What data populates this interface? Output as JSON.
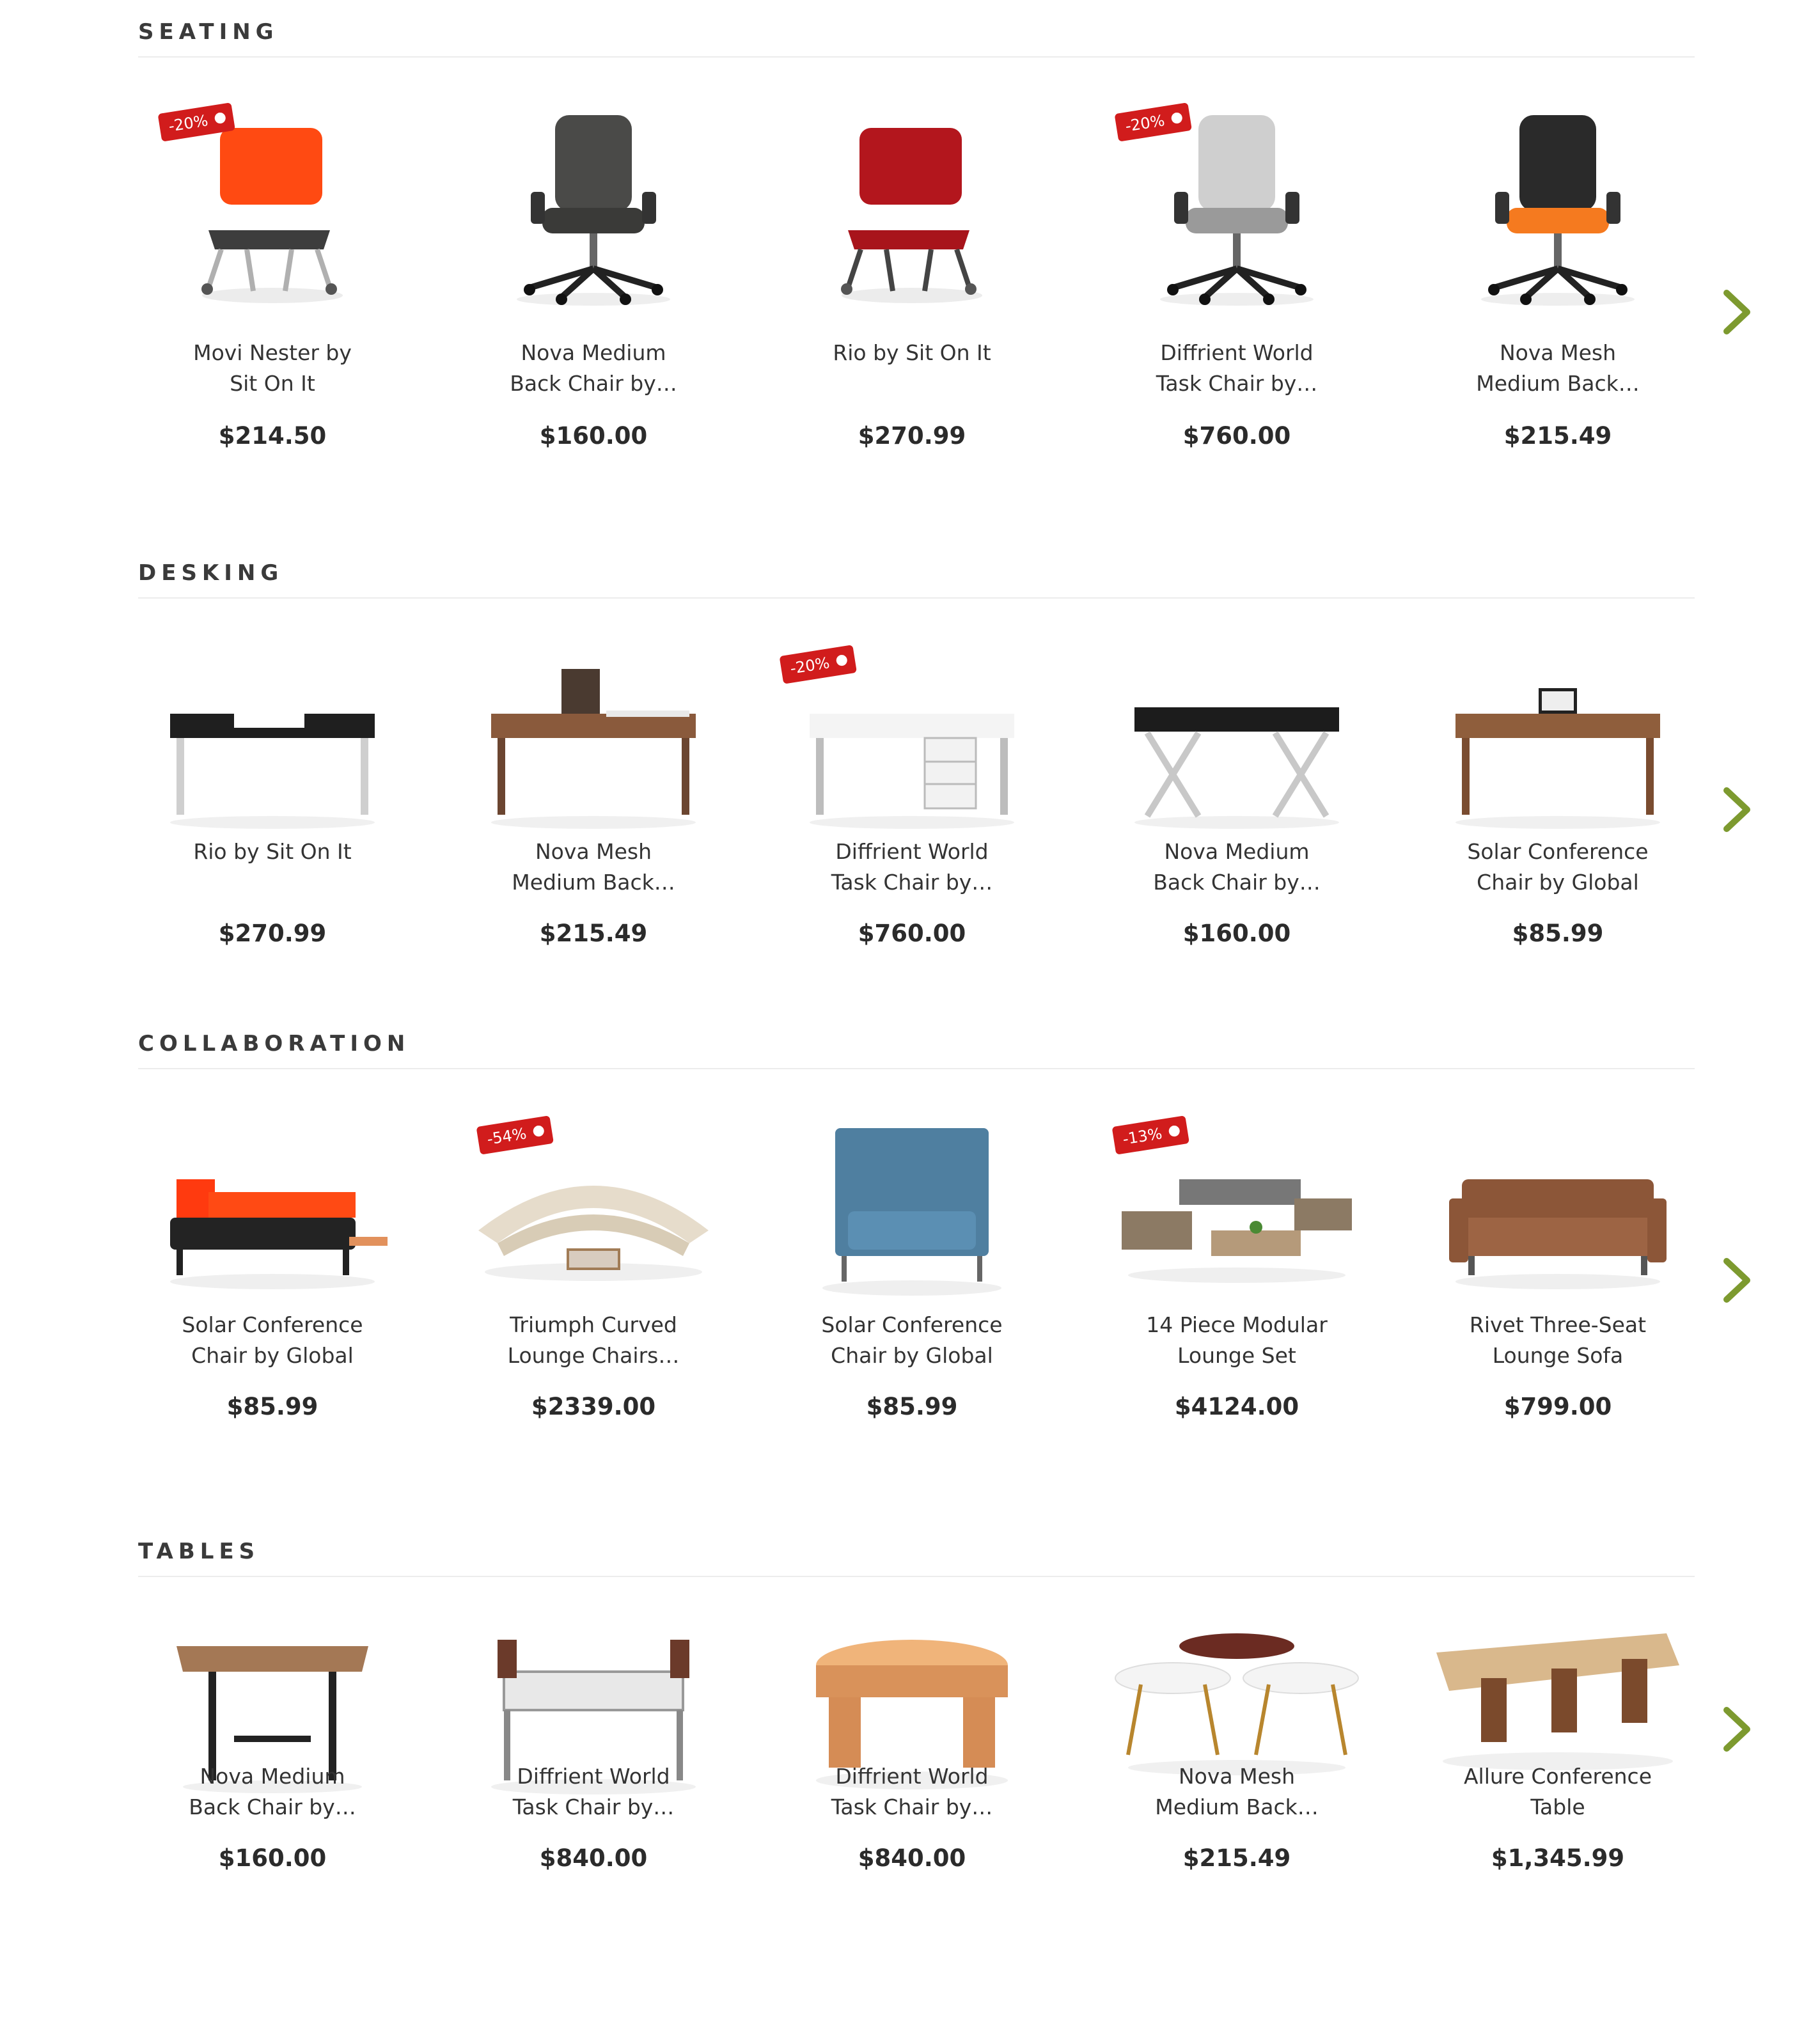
{
  "colors": {
    "accent": "#7d9a2f",
    "sale_badge": "#d11c1c",
    "divider": "#ececec"
  },
  "sections": [
    {
      "title": "SEATING",
      "next_icon": "chevron-right-icon",
      "products": [
        {
          "name": "Movi Nester by\nSit On It",
          "price": "$214.50",
          "badge": "-20%",
          "image": "orange-nesting-chair"
        },
        {
          "name": "Nova Medium\nBack Chair by…",
          "price": "$160.00",
          "badge": "",
          "image": "black-leather-office-chair"
        },
        {
          "name": "Rio by Sit On It",
          "price": "$270.99",
          "badge": "",
          "image": "red-stacking-chair"
        },
        {
          "name": "Diffrient World\nTask Chair by…",
          "price": "$760.00",
          "badge": "-20%",
          "image": "grey-mesh-task-chair"
        },
        {
          "name": "Nova Mesh\nMedium Back…",
          "price": "$215.49",
          "badge": "",
          "image": "mesh-chair-orange-seat"
        }
      ]
    },
    {
      "title": "DESKING",
      "next_icon": "chevron-right-icon",
      "products": [
        {
          "name": "Rio by Sit On It",
          "price": "$270.99",
          "badge": "",
          "image": "black-white-desk"
        },
        {
          "name": "Nova Mesh\nMedium Back…",
          "price": "$215.49",
          "badge": "",
          "image": "walnut-desk-with-chair"
        },
        {
          "name": "Diffrient World\nTask Chair by…",
          "price": "$760.00",
          "badge": "-20%",
          "image": "white-desk-with-drawers"
        },
        {
          "name": "Nova Medium\nBack Chair by…",
          "price": "$160.00",
          "badge": "",
          "image": "x-leg-black-desk"
        },
        {
          "name": "Solar Conference\nChair by Global",
          "price": "$85.99",
          "badge": "",
          "image": "wood-writing-desk"
        }
      ]
    },
    {
      "title": "COLLABORATION",
      "next_icon": "chevron-right-icon",
      "products": [
        {
          "name": "Solar Conference\nChair by Global",
          "price": "$85.99",
          "badge": "",
          "image": "black-orange-lounge-bench"
        },
        {
          "name": "Triumph Curved\nLounge Chairs…",
          "price": "$2339.00",
          "badge": "-54%",
          "image": "curved-cream-sofa"
        },
        {
          "name": "Solar Conference\nChair by Global",
          "price": "$85.99",
          "badge": "",
          "image": "blue-high-back-sofa"
        },
        {
          "name": "14 Piece Modular\nLounge Set",
          "price": "$4124.00",
          "badge": "-13%",
          "image": "modular-lounge-set"
        },
        {
          "name": "Rivet Three-Seat\nLounge Sofa",
          "price": "$799.00",
          "badge": "",
          "image": "brown-leather-sofa"
        }
      ]
    },
    {
      "title": "TABLES",
      "next_icon": "chevron-right-icon",
      "products": [
        {
          "name": "Nova Medium\nBack Chair by…",
          "price": "$160.00",
          "badge": "",
          "image": "wood-table-black-base"
        },
        {
          "name": "Diffrient World\nTask Chair by…",
          "price": "$840.00",
          "badge": "",
          "image": "benching-workstation"
        },
        {
          "name": "Diffrient World\nTask Chair by…",
          "price": "$840.00",
          "badge": "",
          "image": "round-wood-coffee-table"
        },
        {
          "name": "Nova Mesh\nMedium Back…",
          "price": "$215.49",
          "badge": "",
          "image": "nesting-side-tables"
        },
        {
          "name": "Allure Conference\nTable",
          "price": "$1,345.99",
          "badge": "",
          "image": "long-conference-table"
        }
      ]
    }
  ]
}
